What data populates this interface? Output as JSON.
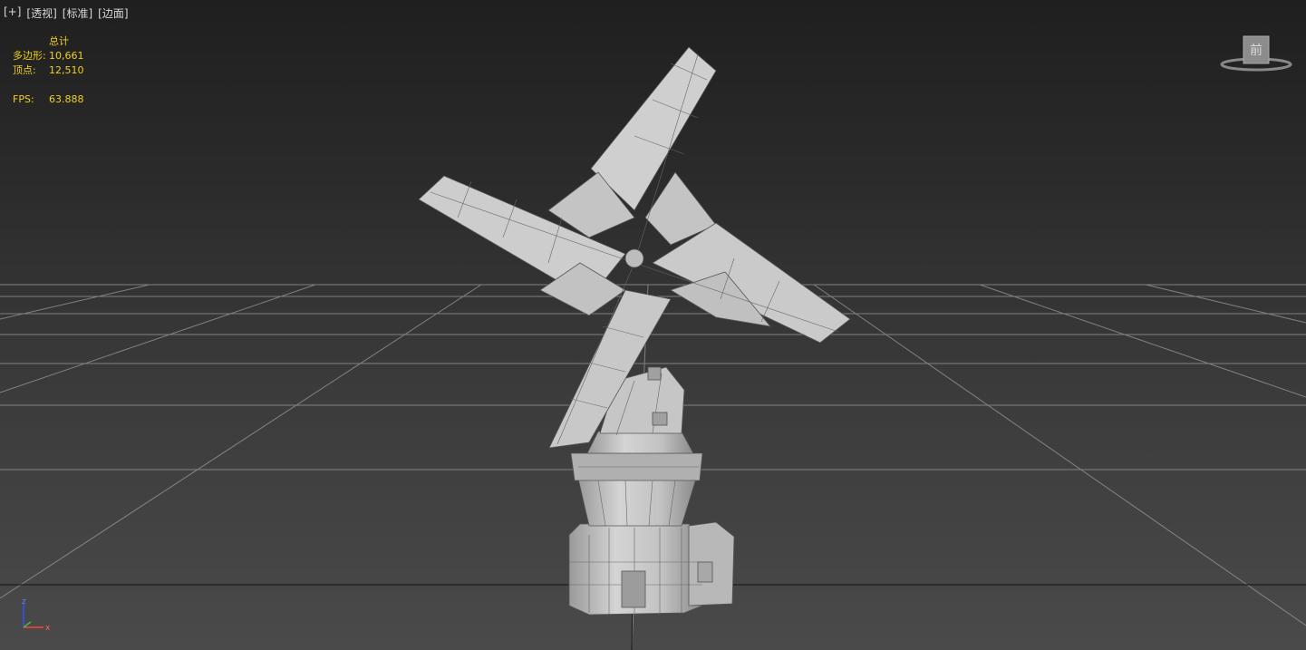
{
  "viewport": {
    "labels": {
      "plus": "[+]",
      "view": "[透视]",
      "shading": "[标准]",
      "style": "[边面]"
    },
    "stats": {
      "header": "总计",
      "polys_label": "多边形:",
      "polys_value": "10,661",
      "verts_label": "顶点:",
      "verts_value": "12,510",
      "fps_label": "FPS:",
      "fps_value": "63.888"
    },
    "viewcube_face": "前",
    "axis": {
      "z": "z",
      "x": "x"
    },
    "colors": {
      "stats_text": "#f0d020",
      "grid_line": "#9a9a9a",
      "model_fill": "#c8c8c8",
      "model_edge": "#5a5a5a",
      "axis_z": "#3050ff",
      "axis_x": "#ff4040"
    }
  }
}
